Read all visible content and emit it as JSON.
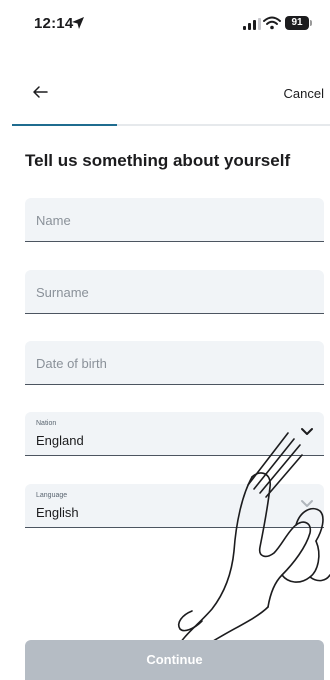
{
  "status": {
    "time": "12:14",
    "battery": "91"
  },
  "nav": {
    "cancel_label": "Cancel"
  },
  "progress": {
    "fraction": 0.33
  },
  "form": {
    "title": "Tell us something about yourself",
    "name_placeholder": "Name",
    "surname_placeholder": "Surname",
    "dob_placeholder": "Date of birth",
    "nation": {
      "label": "Nation",
      "value": "England"
    },
    "language": {
      "label": "Language",
      "value": "English"
    }
  },
  "footer": {
    "continue_label": "Continue"
  },
  "colors": {
    "accent": "#1f6c8f",
    "field_bg": "#f1f4f7",
    "button_disabled": "#b5bcc4"
  }
}
